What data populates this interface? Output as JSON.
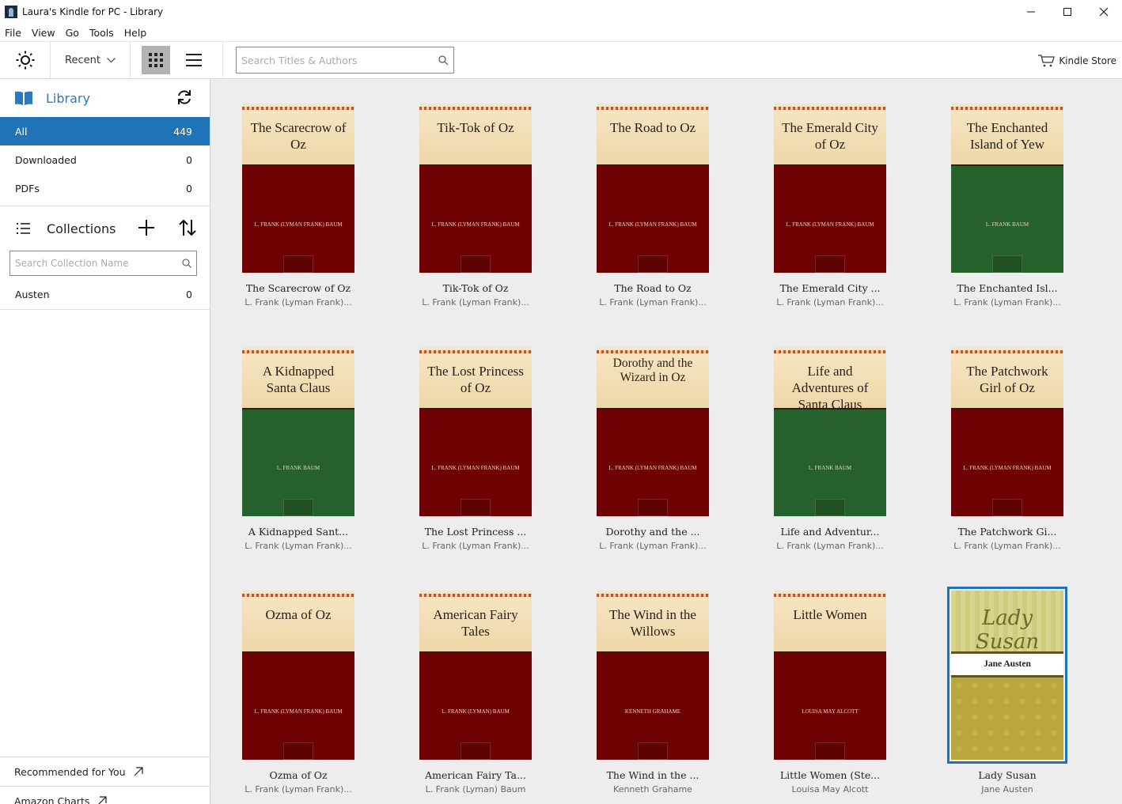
{
  "window": {
    "title": "Laura's Kindle for PC - Library",
    "controls": {
      "minimize": "minimize-icon",
      "maximize": "maximize-icon",
      "close": "close-icon"
    }
  },
  "menu": [
    "File",
    "View",
    "Go",
    "Tools",
    "Help"
  ],
  "toolbar": {
    "sort_label": "Recent",
    "search_placeholder": "Search Titles & Authors",
    "search_value": "",
    "store_label": "Kindle Store",
    "active_view": "grid"
  },
  "sidebar": {
    "library_label": "Library",
    "filters": [
      {
        "label": "All",
        "count": "449",
        "active": true
      },
      {
        "label": "Downloaded",
        "count": "0",
        "active": false
      },
      {
        "label": "PDFs",
        "count": "0",
        "active": false
      }
    ],
    "collections_label": "Collections",
    "collection_search_placeholder": "Search Collection Name",
    "collections": [
      {
        "label": "Austen",
        "count": "0"
      }
    ],
    "footer_links": [
      "Recommended for You",
      "Amazon Charts"
    ]
  },
  "books": [
    {
      "cover_title": "The Scarecrow of Oz",
      "cover_author": "L. FRANK (LYMAN FRANK) BAUM",
      "cover_color": "red",
      "title": "The Scarecrow of Oz",
      "author": "L. Frank (Lyman Frank)..."
    },
    {
      "cover_title": "Tik-Tok of Oz",
      "cover_author": "L. FRANK (LYMAN FRANK) BAUM",
      "cover_color": "red",
      "title": "Tik-Tok of Oz",
      "author": "L. Frank (Lyman Frank)..."
    },
    {
      "cover_title": "The Road to Oz",
      "cover_author": "L. FRANK (LYMAN FRANK) BAUM",
      "cover_color": "red",
      "title": "The Road to Oz",
      "author": "L. Frank (Lyman Frank)..."
    },
    {
      "cover_title": "The Emerald City of Oz",
      "cover_author": "L. FRANK (LYMAN FRANK) BAUM",
      "cover_color": "red",
      "title": "The Emerald City ...",
      "author": "L. Frank (Lyman Frank)..."
    },
    {
      "cover_title": "The Enchanted Island of Yew",
      "cover_author": "L. FRANK BAUM",
      "cover_color": "green",
      "title": "The Enchanted Isl...",
      "author": "L. Frank (Lyman Frank)..."
    },
    {
      "cover_title": "A Kidnapped Santa Claus",
      "cover_author": "L. FRANK BAUM",
      "cover_color": "green",
      "title": "A Kidnapped Sant...",
      "author": "L. Frank (Lyman Frank)..."
    },
    {
      "cover_title": "The Lost Princess of Oz",
      "cover_author": "L. FRANK (LYMAN FRANK) BAUM",
      "cover_color": "red",
      "title": "The Lost Princess ...",
      "author": "L. Frank (Lyman Frank)..."
    },
    {
      "cover_title": "Dorothy and the Wizard in Oz",
      "cover_author": "L. FRANK (LYMAN FRANK) BAUM",
      "cover_color": "red",
      "title": "Dorothy and the ...",
      "author": "L. Frank (Lyman Frank)..."
    },
    {
      "cover_title": "Life and Adventures of Santa Claus",
      "cover_author": "L. FRANK BAUM",
      "cover_color": "green",
      "title": "Life and Adventur...",
      "author": "L. Frank (Lyman Frank)..."
    },
    {
      "cover_title": "The Patchwork Girl of Oz",
      "cover_author": "L. FRANK (LYMAN FRANK) BAUM",
      "cover_color": "red",
      "title": "The Patchwork Gi...",
      "author": "L. Frank (Lyman Frank)..."
    },
    {
      "cover_title": "Ozma of Oz",
      "cover_author": "L. FRANK (LYMAN FRANK) BAUM",
      "cover_color": "red",
      "title": "Ozma of Oz",
      "author": "L. Frank (Lyman Frank)..."
    },
    {
      "cover_title": "American Fairy Tales",
      "cover_author": "L. FRANK (LYMAN) BAUM",
      "cover_color": "red",
      "title": "American Fairy Ta...",
      "author": "L. Frank (Lyman) Baum"
    },
    {
      "cover_title": "The Wind in the Willows",
      "cover_author": "KENNETH GRAHAME",
      "cover_color": "red",
      "title": "The Wind in the ...",
      "author": "Kenneth Grahame"
    },
    {
      "cover_title": "Little Women",
      "cover_author": "LOUISA MAY ALCOTT",
      "cover_color": "red",
      "title": "Little Women (Ste...",
      "author": "Louisa May Alcott"
    },
    {
      "cover_title": "Lady Susan",
      "cover_author": "Jane Austen",
      "cover_color": "olive",
      "title": "Lady Susan",
      "author": "Jane Austen",
      "selected": true
    }
  ]
}
